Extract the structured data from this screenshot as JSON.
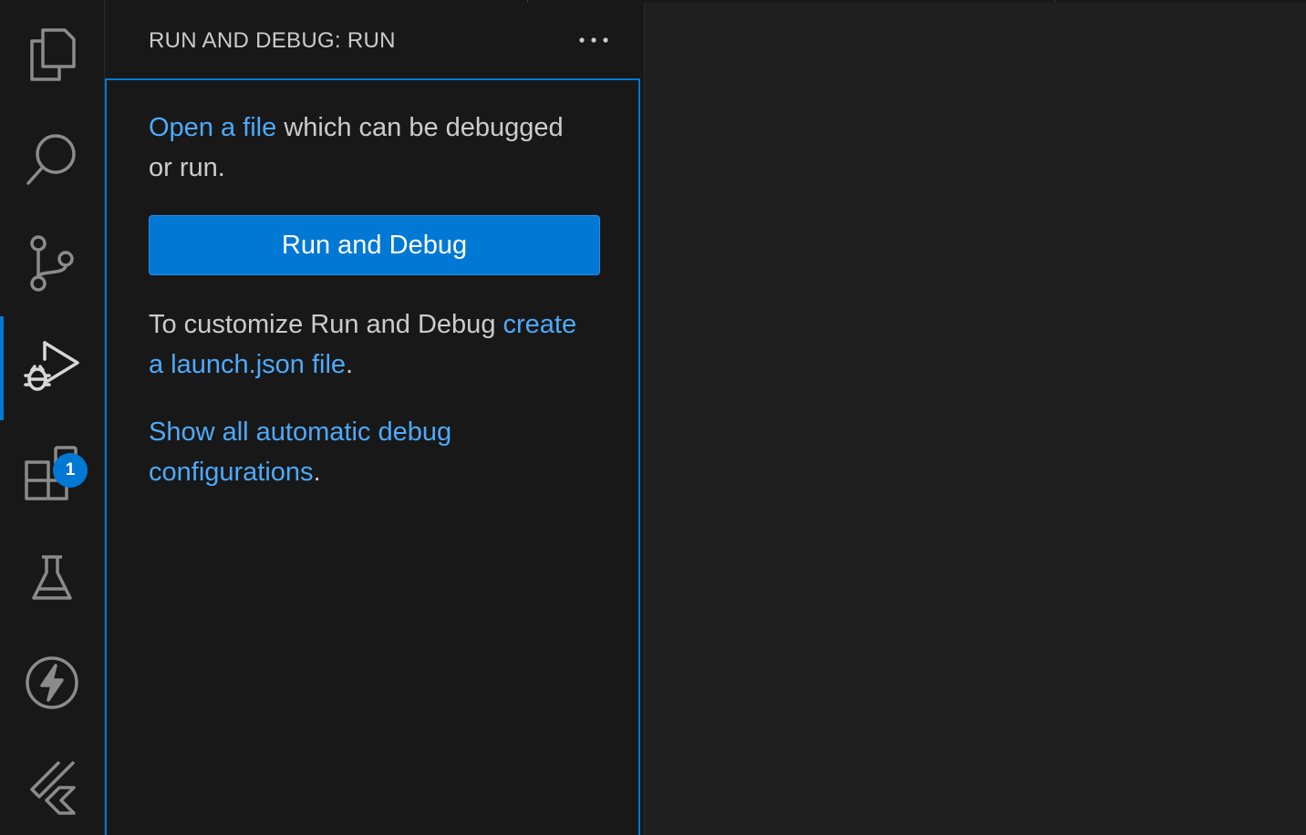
{
  "activity_bar": {
    "items": [
      {
        "icon": "files-icon",
        "name": "explorer"
      },
      {
        "icon": "search-icon",
        "name": "search"
      },
      {
        "icon": "source-control-icon",
        "name": "source-control"
      },
      {
        "icon": "run-debug-icon",
        "name": "run-and-debug",
        "active": true
      },
      {
        "icon": "extensions-icon",
        "name": "extensions",
        "badge": "1"
      },
      {
        "icon": "testing-icon",
        "name": "testing"
      },
      {
        "icon": "lightning-icon",
        "name": "lightning"
      },
      {
        "icon": "flutter-icon",
        "name": "flutter"
      }
    ]
  },
  "sidebar": {
    "title": "RUN AND DEBUG: RUN",
    "more_icon": "ellipsis-icon",
    "open_file": {
      "link": "Open a file",
      "text": " which can be debugged or run."
    },
    "run_button": "Run and Debug",
    "customize": {
      "text": "To customize Run and Debug ",
      "link": "create a launch.json file",
      "suffix": "."
    },
    "show_all": {
      "link": "Show all automatic debug configurations",
      "suffix": "."
    }
  },
  "colors": {
    "accent": "#0078d4",
    "link": "#4daafc",
    "text": "#cccccc",
    "sidebar_bg": "#181818",
    "editor_bg": "#1f1f1f"
  }
}
